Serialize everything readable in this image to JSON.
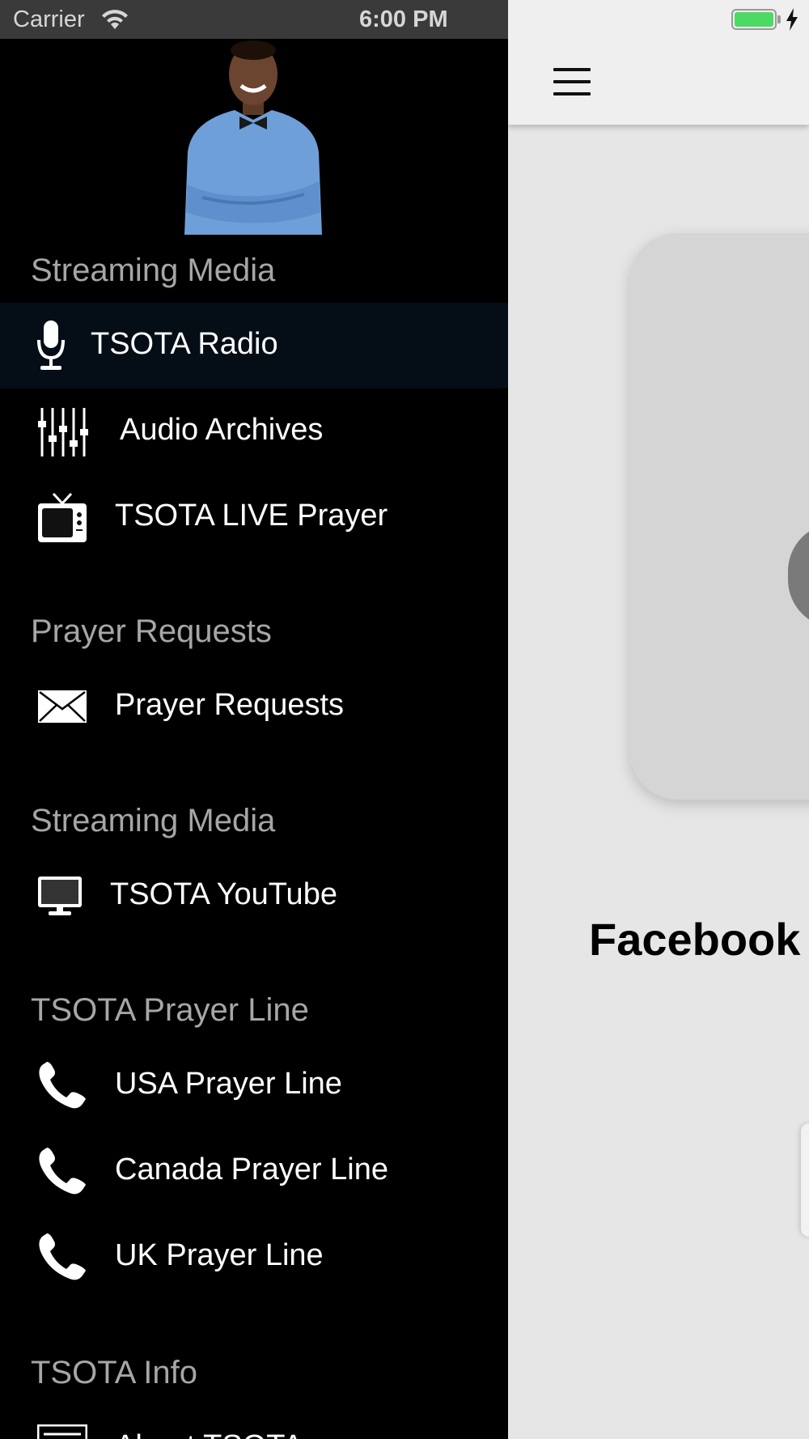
{
  "status_bar": {
    "carrier": "Carrier",
    "time": "6:00 PM",
    "battery_color": "#4cd964"
  },
  "drawer": {
    "sections": [
      {
        "header": "Streaming Media",
        "items": [
          {
            "label": "TSOTA Radio",
            "icon": "microphone-icon",
            "active": true
          },
          {
            "label": "Audio Archives",
            "icon": "equalizer-icon"
          },
          {
            "label": "TSOTA LIVE Prayer",
            "icon": "tv-icon"
          }
        ]
      },
      {
        "header": "Prayer Requests",
        "items": [
          {
            "label": "Prayer Requests",
            "icon": "envelope-icon"
          }
        ]
      },
      {
        "header": "Streaming Media",
        "items": [
          {
            "label": "TSOTA YouTube",
            "icon": "monitor-icon"
          }
        ]
      },
      {
        "header": "TSOTA Prayer Line",
        "items": [
          {
            "label": "USA Prayer Line",
            "icon": "phone-icon"
          },
          {
            "label": "Canada Prayer Line",
            "icon": "phone-icon"
          },
          {
            "label": "UK Prayer Line",
            "icon": "phone-icon"
          }
        ]
      },
      {
        "header": "TSOTA Info",
        "items": [
          {
            "label": "About TSOTA",
            "icon": "document-icon"
          }
        ]
      }
    ]
  },
  "main": {
    "title": "Facebook"
  }
}
